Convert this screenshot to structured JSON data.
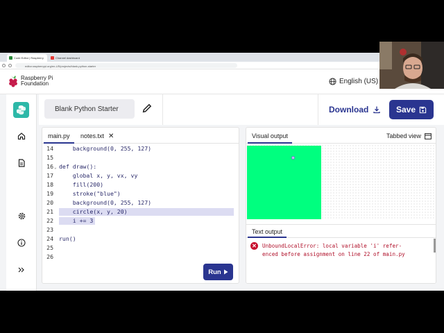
{
  "browser": {
    "tabs": [
      {
        "label": "Code Editor | Raspberry",
        "favicon_color": "#2a8a3a"
      },
      {
        "label": "Channel dashboard",
        "favicon_color": "#e53935"
      }
    ],
    "url": "editor.raspberrypi.org/en-US/projects/blank-python-starter"
  },
  "header": {
    "brand_line1": "Raspberry Pi",
    "brand_line2": "Foundation",
    "language": "English (US)"
  },
  "toolbar": {
    "project_name": "Blank Python Starter",
    "download_label": "Download",
    "save_label": "Save"
  },
  "editor": {
    "tabs": [
      {
        "label": "main.py",
        "active": true
      },
      {
        "label": "notes.txt",
        "active": false
      }
    ],
    "lines": [
      {
        "n": "14",
        "text": "    background(0, 255, 127)"
      },
      {
        "n": "15",
        "text": ""
      },
      {
        "n": "16",
        "text": "def draw():"
      },
      {
        "n": "17",
        "text": "    global x, y, vx, vy"
      },
      {
        "n": "18",
        "text": "    fill(200)"
      },
      {
        "n": "19",
        "text": "    stroke(\"blue\")"
      },
      {
        "n": "20",
        "text": "    background(0, 255, 127)"
      },
      {
        "n": "21",
        "text": "    circle(x, y, 20)"
      },
      {
        "n": "22",
        "text": "    i += 3"
      },
      {
        "n": "23",
        "text": ""
      },
      {
        "n": "24",
        "text": "run()"
      },
      {
        "n": "25",
        "text": ""
      },
      {
        "n": "26",
        "text": ""
      }
    ],
    "run_label": "Run"
  },
  "output": {
    "visual_tab": "Visual output",
    "tabbed_view": "Tabbed view",
    "canvas_color": "#00ff7f",
    "text_tab": "Text output",
    "error": "UnboundLocalError: local variable 'i' refer-\nenced before assignment on line 22 of main.py"
  },
  "colors": {
    "accent": "#2a3590",
    "python_logo_bg": "#2db8a8",
    "error": "#c8102e"
  }
}
